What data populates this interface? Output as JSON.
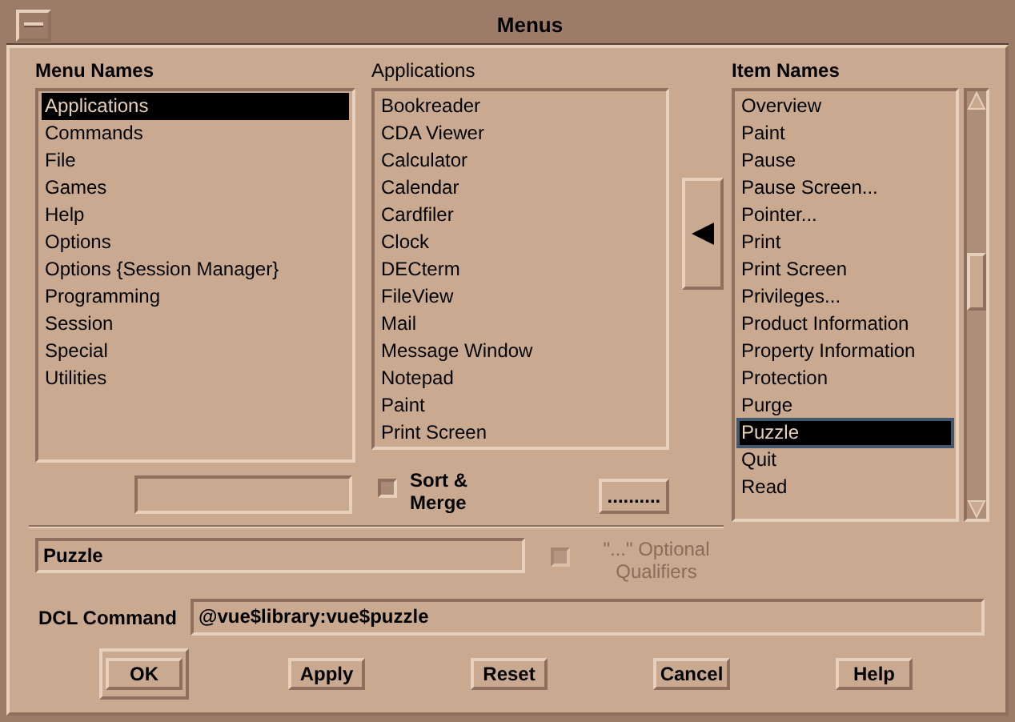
{
  "window": {
    "title": "Menus"
  },
  "menu_names": {
    "label": "Menu Names",
    "items": [
      {
        "label": "Applications",
        "selected": true
      },
      {
        "label": "Commands",
        "selected": false
      },
      {
        "label": "File",
        "selected": false
      },
      {
        "label": "Games",
        "selected": false
      },
      {
        "label": "Help",
        "selected": false
      },
      {
        "label": "Options",
        "selected": false
      },
      {
        "label": "Options {Session Manager}",
        "selected": false
      },
      {
        "label": "Programming",
        "selected": false
      },
      {
        "label": "Session",
        "selected": false
      },
      {
        "label": "Special",
        "selected": false
      },
      {
        "label": "Utilities",
        "selected": false
      }
    ]
  },
  "applications": {
    "label": "Applications",
    "items": [
      {
        "label": "Bookreader",
        "selected": false
      },
      {
        "label": "CDA Viewer",
        "selected": false
      },
      {
        "label": "Calculator",
        "selected": false
      },
      {
        "label": "Calendar",
        "selected": false
      },
      {
        "label": "Cardfiler",
        "selected": false
      },
      {
        "label": "Clock",
        "selected": false
      },
      {
        "label": "DECterm",
        "selected": false
      },
      {
        "label": "FileView",
        "selected": false
      },
      {
        "label": "Mail",
        "selected": false
      },
      {
        "label": "Message Window",
        "selected": false
      },
      {
        "label": "Notepad",
        "selected": false
      },
      {
        "label": "Paint",
        "selected": false
      },
      {
        "label": "Print Screen",
        "selected": false
      }
    ]
  },
  "sort_merge": {
    "label": "Sort & Merge",
    "checked": false
  },
  "ellipsis_button": {
    "label": ".........."
  },
  "item_names": {
    "label": "Item Names",
    "items": [
      {
        "label": "Overview",
        "selected": false
      },
      {
        "label": "Paint",
        "selected": false
      },
      {
        "label": "Pause",
        "selected": false
      },
      {
        "label": "Pause Screen...",
        "selected": false
      },
      {
        "label": "Pointer...",
        "selected": false
      },
      {
        "label": "Print",
        "selected": false
      },
      {
        "label": "Print Screen",
        "selected": false
      },
      {
        "label": "Privileges...",
        "selected": false
      },
      {
        "label": "Product Information",
        "selected": false
      },
      {
        "label": "Property Information",
        "selected": false
      },
      {
        "label": "Protection",
        "selected": false
      },
      {
        "label": "Purge",
        "selected": false
      },
      {
        "label": "Puzzle",
        "selected": true
      },
      {
        "label": "Quit",
        "selected": false
      },
      {
        "label": "Read",
        "selected": false
      }
    ]
  },
  "item_field": {
    "value": "Puzzle"
  },
  "optional_qualifiers": {
    "label": "\"...\" Optional Qualifiers",
    "checked": false,
    "disabled": true
  },
  "dcl_command": {
    "label": "DCL Command",
    "value": "@vue$library:vue$puzzle"
  },
  "buttons": [
    {
      "label": "OK",
      "default": true
    },
    {
      "label": "Apply",
      "default": false
    },
    {
      "label": "Reset",
      "default": false
    },
    {
      "label": "Cancel",
      "default": false
    },
    {
      "label": "Help",
      "default": false
    }
  ]
}
